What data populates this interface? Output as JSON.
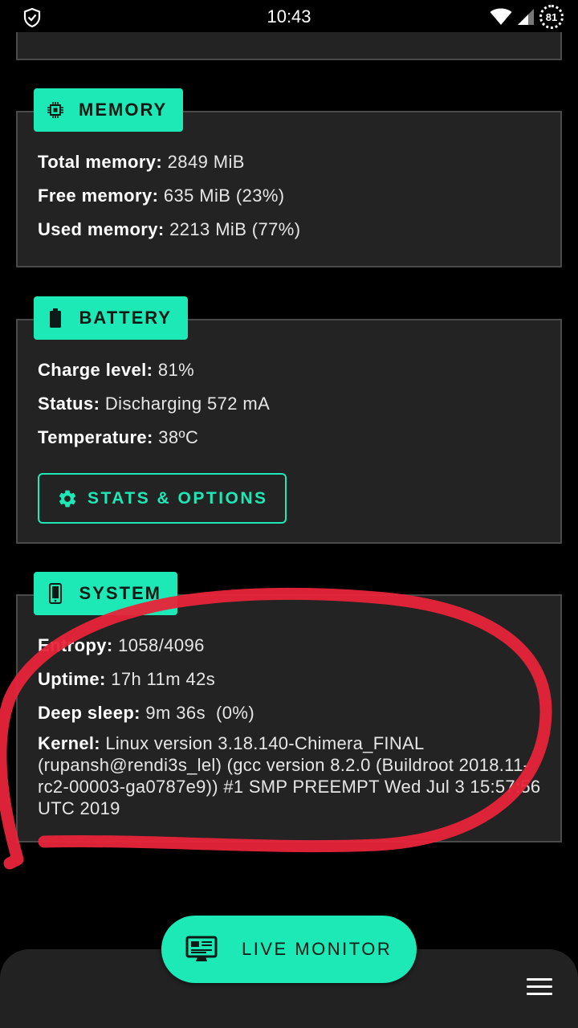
{
  "status_bar": {
    "time": "10:43",
    "battery_percent": "81",
    "left_icon": "shield-check-icon",
    "right_icons": [
      "wifi-icon",
      "cellular-signal-icon",
      "battery-ring-icon"
    ]
  },
  "memory": {
    "title": "MEMORY",
    "icon": "chip-icon",
    "total_label": "Total memory:",
    "total_value": "2849 MiB",
    "free_label": "Free memory:",
    "free_value": "635 MiB (23%)",
    "used_label": "Used memory:",
    "used_value": "2213 MiB (77%)"
  },
  "battery": {
    "title": "BATTERY",
    "icon": "battery-icon",
    "charge_label": "Charge level:",
    "charge_value": "81%",
    "status_label": "Status:",
    "status_value": "Discharging 572 mA",
    "temp_label": "Temperature:",
    "temp_value": "38ºC",
    "button_label": "STATS & OPTIONS",
    "button_icon": "gear-icon"
  },
  "system": {
    "title": "SYSTEM",
    "icon": "phone-icon",
    "entropy_label": "Entropy:",
    "entropy_value": "1058/4096",
    "uptime_label": "Uptime:",
    "uptime_value": "17h 11m 42s",
    "sleep_label": "Deep sleep:",
    "sleep_value": "9m 36s  (0%)",
    "kernel_label": "Kernel:",
    "kernel_value": "Linux version 3.18.140-Chimera_FINAL (rupansh@rendi3s_lel) (gcc version 8.2.0 (Buildroot 2018.11-rc2-00003-ga0787e9)) #1 SMP PREEMPT Wed Jul 3 15:57:56 UTC 2019"
  },
  "fab": {
    "label": "LIVE MONITOR",
    "icon": "monitor-icon"
  },
  "bottom_bar": {
    "menu_icon": "hamburger-menu-icon"
  },
  "colors": {
    "accent": "#1de9b6",
    "card_bg": "#232323",
    "annotation": "#e8243a"
  }
}
